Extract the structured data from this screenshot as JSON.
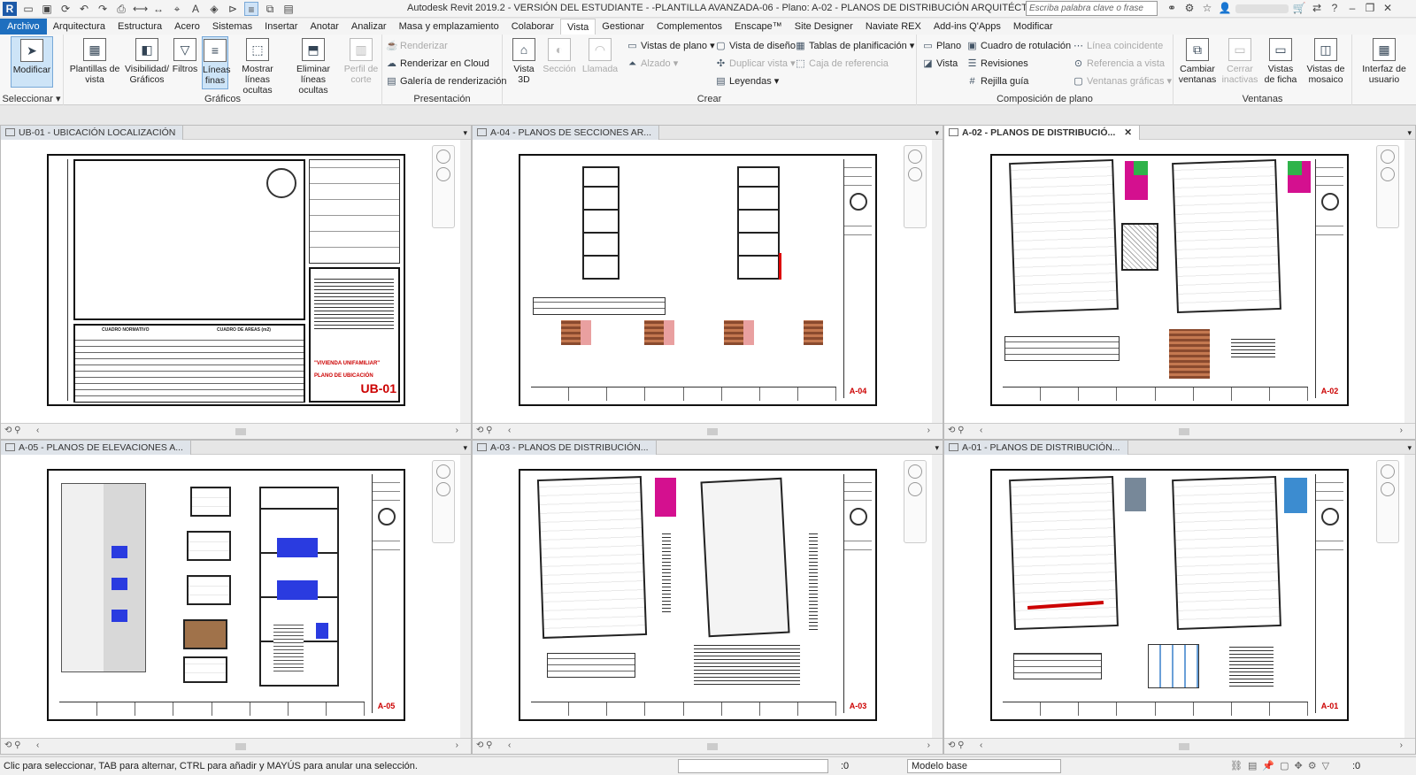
{
  "titlebar": {
    "title": "Autodesk Revit 2019.2 - VERSIÓN DEL ESTUDIANTE -      -PLANTILLA AVANZADA-06 - Plano: A-02 - PLANOS DE DISTRIBUCIÓN ARQUITÉCTONICA",
    "search_placeholder": "Escriba palabra clave o frase",
    "logo": "R"
  },
  "menu": [
    "Archivo",
    "Arquitectura",
    "Estructura",
    "Acero",
    "Sistemas",
    "Insertar",
    "Anotar",
    "Analizar",
    "Masa y emplazamiento",
    "Colaborar",
    "Vista",
    "Gestionar",
    "Complementos",
    "Enscape™",
    "Site Designer",
    "Naviate REX",
    "Add-ins Q'Apps",
    "Modificar"
  ],
  "ribbon": {
    "seleccionar": {
      "label": "Seleccionar ▾",
      "btn": "Modificar"
    },
    "graficos": {
      "label": "Gráficos",
      "btns": [
        "Plantillas de vista",
        "Visibilidad/ Gráficos",
        "Filtros",
        "Líneas finas",
        "Mostrar líneas ocultas",
        "Eliminar líneas ocultas",
        "Perfil de corte"
      ]
    },
    "presentacion": {
      "label": "Presentación",
      "btns": [
        "Renderizar",
        "Renderizar  en Cloud",
        "Galería de  renderización"
      ]
    },
    "crear": {
      "label": "Crear",
      "big": [
        "Vista 3D",
        "Sección",
        "Llamada"
      ],
      "small": [
        "Vistas de plano ▾",
        "Alzado ▾",
        "Vista de diseño",
        "Duplicar vista ▾",
        "Leyendas ▾",
        "Tablas de planificación ▾",
        "Caja de referencia"
      ]
    },
    "composicion": {
      "label": "Composición de plano",
      "small": [
        "Plano",
        "Vista",
        "Cuadro de rotulación",
        "Revisiones",
        "Rejilla guía",
        "Línea coincidente",
        "Referencia a vista",
        "Ventanas gráficas ▾"
      ]
    },
    "ventanas": {
      "label": "Ventanas",
      "btns": [
        "Cambiar ventanas",
        "Cerrar inactivas",
        "Vistas de ficha",
        "Vistas de mosaico"
      ]
    },
    "interfaz": {
      "btn": "Interfaz de usuario"
    }
  },
  "views": [
    {
      "tab": "UB-01 - UBICACIÓN LOCALIZACIÓN",
      "sheet": "UB-01",
      "active": false
    },
    {
      "tab": "A-04 - PLANOS DE SECCIONES AR...",
      "sheet": "A-04",
      "active": false
    },
    {
      "tab": "A-02 - PLANOS DE DISTRIBUCIÓ...",
      "sheet": "A-02",
      "active": true
    },
    {
      "tab": "A-05 - PLANOS DE ELEVACIONES A...",
      "sheet": "A-05",
      "active": false
    },
    {
      "tab": "A-03 - PLANOS DE DISTRIBUCIÓN...",
      "sheet": "A-03",
      "active": false
    },
    {
      "tab": "A-01 - PLANOS DE DISTRIBUCIÓN...",
      "sheet": "A-01",
      "active": false
    }
  ],
  "ub01": {
    "cuadro_normativo": "CUADRO NORMATIVO",
    "cuadro_areas": "CUADRO DE AREAS (m2)",
    "vivienda": "\"VIVIENDA UNIFAMILIAR\"",
    "plano_ubicacion": "PLANO DE UBICACIÓN"
  },
  "status": {
    "message": "Clic para seleccionar, TAB para alternar, CTRL para añadir y MAYÚS para anular una selección.",
    "model": "Modelo base",
    "zero1": ":0",
    "zero2": ":0"
  },
  "colors": {
    "accent": "#1e6fbf",
    "magenta": "#d4108f",
    "green": "#2fb34a",
    "blue": "#2a3be0",
    "red_label": "#c00000"
  }
}
